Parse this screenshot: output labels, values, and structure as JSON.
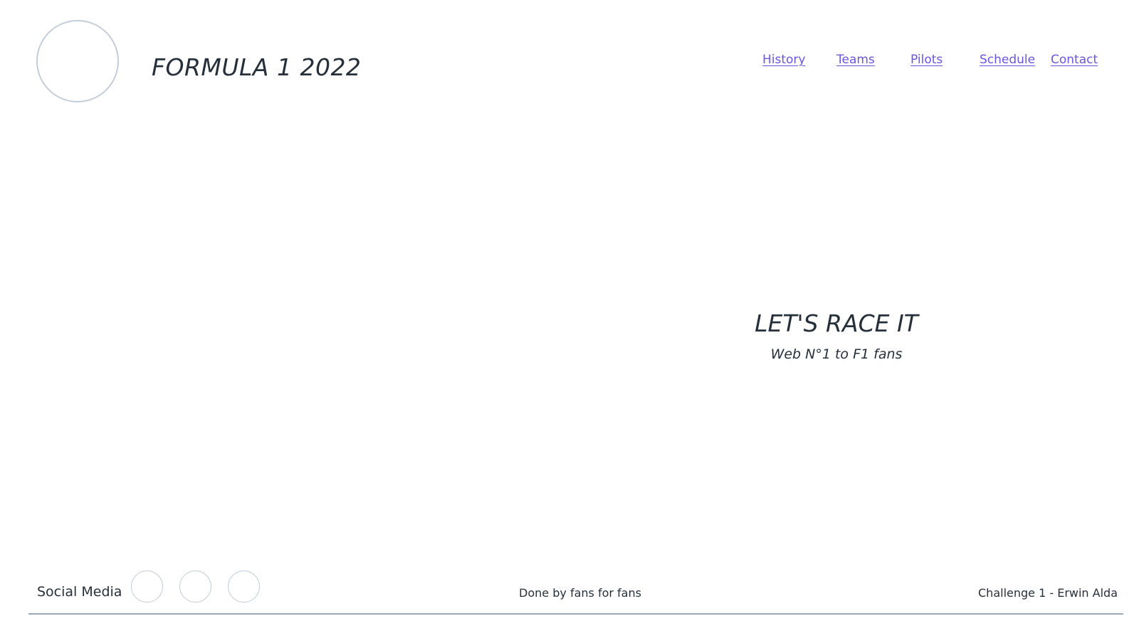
{
  "header": {
    "site_title": "FORMULA 1 2022",
    "logo_icon": "logo-placeholder-circle",
    "nav": [
      {
        "label": "History"
      },
      {
        "label": "Teams"
      },
      {
        "label": "Pilots"
      },
      {
        "label": "Schedule"
      },
      {
        "label": "Contact"
      }
    ]
  },
  "hero": {
    "title": "LET'S RACE IT",
    "subtitle": "Web N°1 to F1 fans"
  },
  "footer": {
    "social_label": "Social Media",
    "social_icons": [
      "social-icon-placeholder",
      "social-icon-placeholder",
      "social-icon-placeholder"
    ],
    "center_text": "Done by fans for fans",
    "right_text": "Challenge 1 - Erwin Alda"
  },
  "colors": {
    "text": "#26303a",
    "link": "#6c54e0",
    "placeholder_border": "#c3ceda",
    "footer_rule": "#9aa9b5"
  }
}
